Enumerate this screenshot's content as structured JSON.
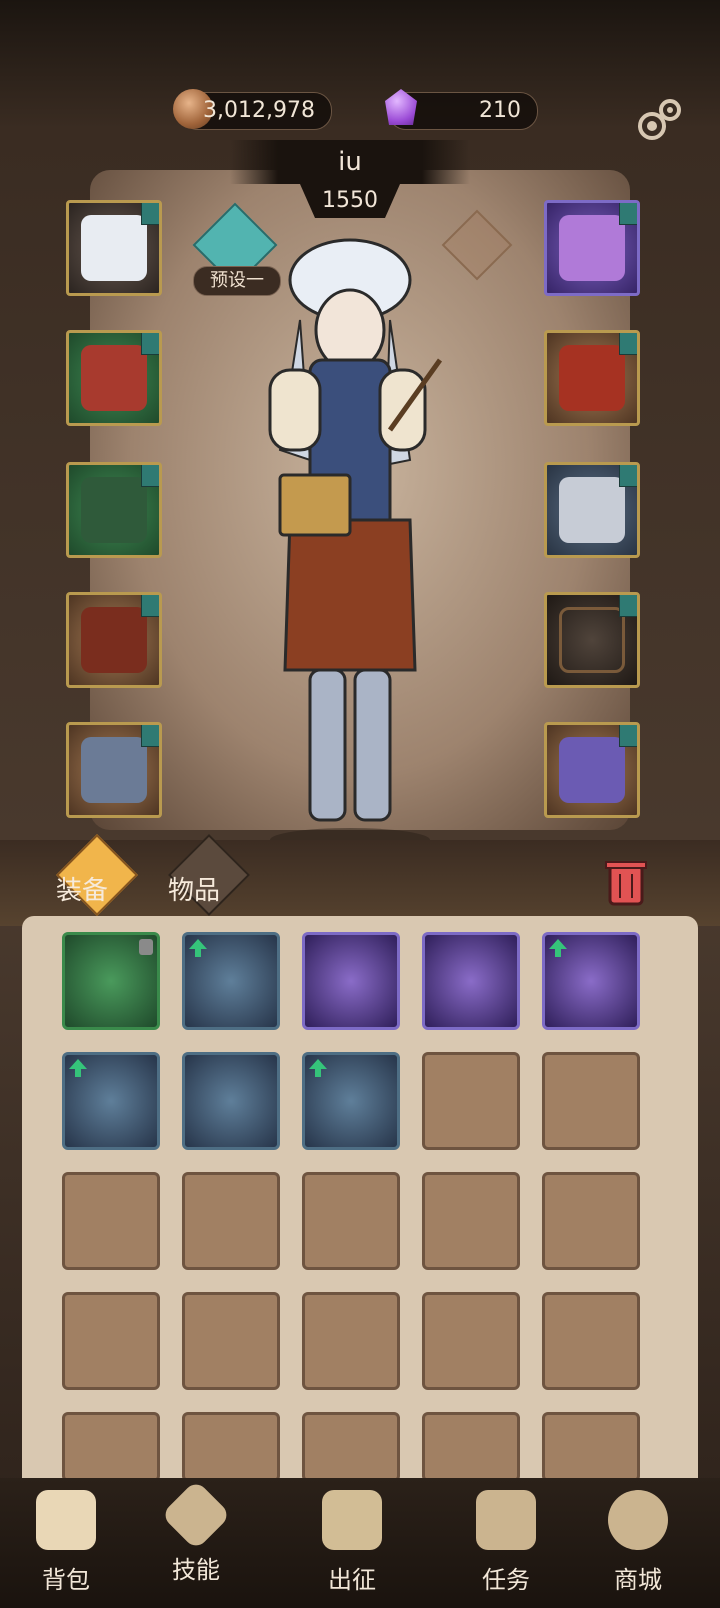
{
  "currency": {
    "coins": "3,012,978",
    "gems": "210"
  },
  "character": {
    "name": "iu",
    "power": "1550",
    "preset_label": "预设一"
  },
  "tabs": [
    "装备",
    "物品"
  ],
  "bottom_nav": [
    "背包",
    "技能",
    "出征",
    "任务",
    "商城"
  ],
  "icons": {
    "coin": "coin-icon",
    "gem": "gem-icon",
    "settings": "gear-icon",
    "preset": "preset-icon",
    "pin": "marker-icon",
    "trash": "trash-icon"
  },
  "colors": {
    "green_rarity": "#3a8a4b",
    "blue_rarity": "#4e6e84",
    "purple_rarity": "#7d6bc6",
    "gold_frame": "#b99a4f",
    "upgrade_arrow": "#35c47a"
  }
}
